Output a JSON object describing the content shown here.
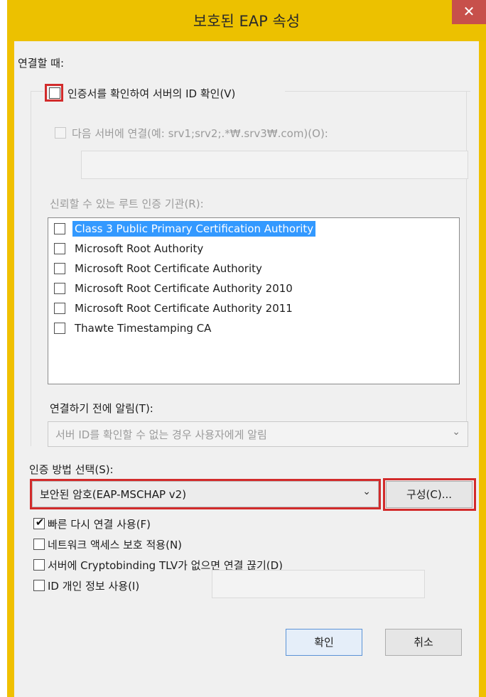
{
  "window": {
    "title": "보호된 EAP 속성",
    "close_icon": "✕"
  },
  "connect": {
    "header": "연결할 때:",
    "verify_cert_label": "인증서를 확인하여 서버의 ID 확인(V)",
    "connect_to_servers_label": "다음 서버에 연결(예: srv1;srv2;.*₩.srv3₩.com)(O):",
    "servers_value": "",
    "trusted_root_label": "신뢰할 수 있는 루트 인증 기관(R):",
    "trusted_roots": [
      {
        "label": "Class 3 Public Primary Certification Authority",
        "checked": false,
        "selected": true
      },
      {
        "label": "Microsoft Root Authority",
        "checked": false,
        "selected": false
      },
      {
        "label": "Microsoft Root Certificate Authority",
        "checked": false,
        "selected": false
      },
      {
        "label": "Microsoft Root Certificate Authority 2010",
        "checked": false,
        "selected": false
      },
      {
        "label": "Microsoft Root Certificate Authority 2011",
        "checked": false,
        "selected": false
      },
      {
        "label": "Thawte Timestamping CA",
        "checked": false,
        "selected": false
      }
    ],
    "notify_label": "연결하기 전에 알림(T):",
    "notify_value": "서버 ID를 확인할 수 없는 경우 사용자에게 알림"
  },
  "auth": {
    "method_label": "인증 방법 선택(S):",
    "method_value": "보안된 암호(EAP-MSCHAP v2)",
    "configure_button": "구성(C)...",
    "options": [
      {
        "label": "빠른 다시 연결 사용(F)",
        "checked": true
      },
      {
        "label": "네트워크 액세스 보호 적용(N)",
        "checked": false
      },
      {
        "label": "서버에 Cryptobinding TLV가 없으면 연결 끊기(D)",
        "checked": false
      },
      {
        "label": "ID 개인 정보 사용(I)",
        "checked": false
      }
    ],
    "identity_value": ""
  },
  "buttons": {
    "ok": "확인",
    "cancel": "취소"
  },
  "colors": {
    "title_bar": "#ecc100",
    "close": "#c7504b",
    "highlight": "#d22b2b",
    "selection": "#3399ff"
  }
}
